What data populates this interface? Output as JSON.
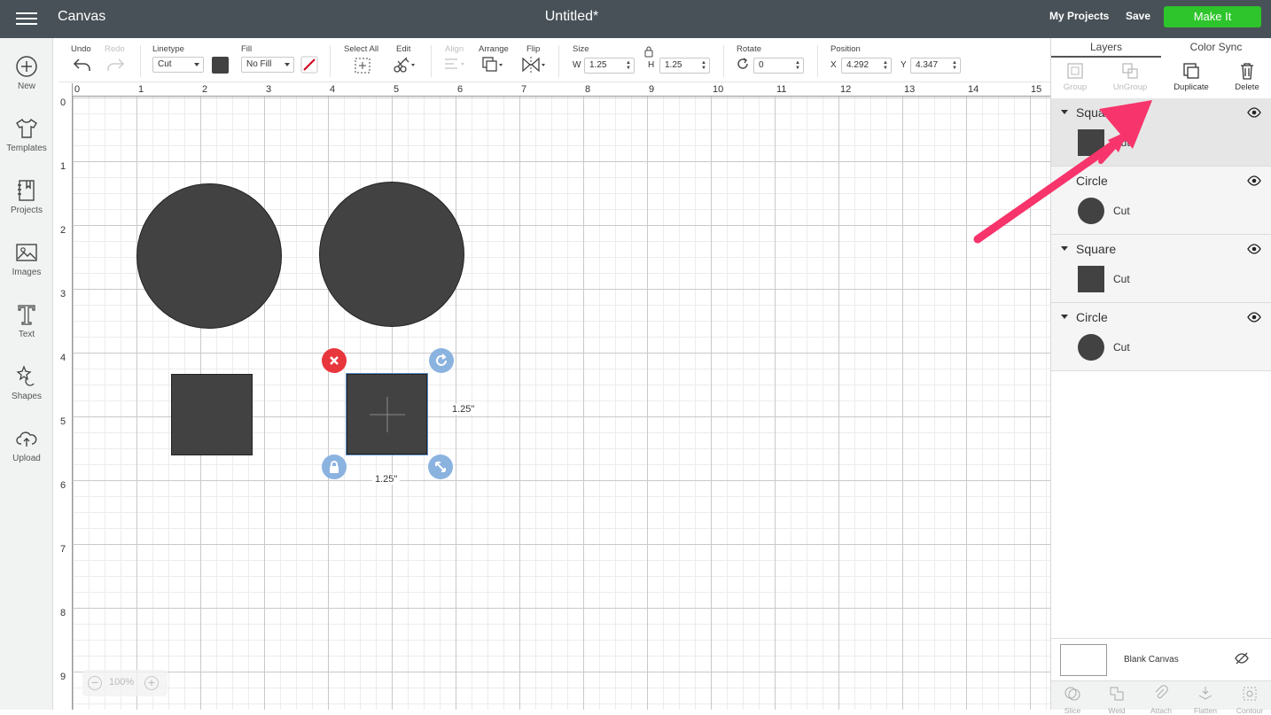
{
  "header": {
    "app_title": "Canvas",
    "doc_title": "Untitled*",
    "my_projects": "My Projects",
    "save": "Save",
    "make_it": "Make It",
    "make_it_color": "#2dc52b"
  },
  "sidebar": {
    "items": [
      {
        "label": "New",
        "icon": "plus-circle-icon"
      },
      {
        "label": "Templates",
        "icon": "tshirt-icon"
      },
      {
        "label": "Projects",
        "icon": "notebook-icon"
      },
      {
        "label": "Images",
        "icon": "image-icon"
      },
      {
        "label": "Text",
        "icon": "text-t-icon"
      },
      {
        "label": "Shapes",
        "icon": "shapes-icon"
      },
      {
        "label": "Upload",
        "icon": "cloud-upload-icon"
      }
    ]
  },
  "toolbar": {
    "undo": "Undo",
    "redo": "Redo",
    "linetype_label": "Linetype",
    "linetype_value": "Cut",
    "fill_label": "Fill",
    "fill_value": "No Fill",
    "select_all": "Select All",
    "edit": "Edit",
    "align": "Align",
    "arrange": "Arrange",
    "flip": "Flip",
    "size_label": "Size",
    "w_label": "W",
    "w_value": "1.25",
    "h_label": "H",
    "h_value": "1.25",
    "rotate_label": "Rotate",
    "rotate_value": "0",
    "position_label": "Position",
    "x_label": "X",
    "x_value": "4.292",
    "y_label": "Y",
    "y_value": "4.347"
  },
  "canvas": {
    "ruler_top": [
      "0",
      "1",
      "2",
      "3",
      "4",
      "5",
      "6",
      "7",
      "8",
      "9",
      "10",
      "11",
      "12",
      "13",
      "14",
      "15"
    ],
    "ruler_left": [
      "0",
      "1",
      "2",
      "3",
      "4",
      "5",
      "6",
      "7",
      "8",
      "9"
    ],
    "selection_width_label": "1.25\"",
    "selection_height_label": "1.25\"",
    "zoom": "100%"
  },
  "panel": {
    "tabs": [
      "Layers",
      "Color Sync"
    ],
    "actions": [
      {
        "label": "Group",
        "icon": "group-icon",
        "enabled": false
      },
      {
        "label": "UnGroup",
        "icon": "ungroup-icon",
        "enabled": false
      },
      {
        "label": "Duplicate",
        "icon": "duplicate-icon",
        "enabled": true
      },
      {
        "label": "Delete",
        "icon": "trash-icon",
        "enabled": true
      }
    ],
    "layers": [
      {
        "name": "Square",
        "op": "Cut",
        "shape": "square",
        "selected": true
      },
      {
        "name": "Circle",
        "op": "Cut",
        "shape": "circle",
        "selected": false
      },
      {
        "name": "Square",
        "op": "Cut",
        "shape": "square",
        "selected": false
      },
      {
        "name": "Circle",
        "op": "Cut",
        "shape": "circle",
        "selected": false
      }
    ],
    "blank_canvas": "Blank Canvas",
    "bottom_actions": [
      "Slice",
      "Weld",
      "Attach",
      "Flatten",
      "Contour"
    ]
  },
  "annotation": {
    "arrow_color": "#f7346b"
  }
}
